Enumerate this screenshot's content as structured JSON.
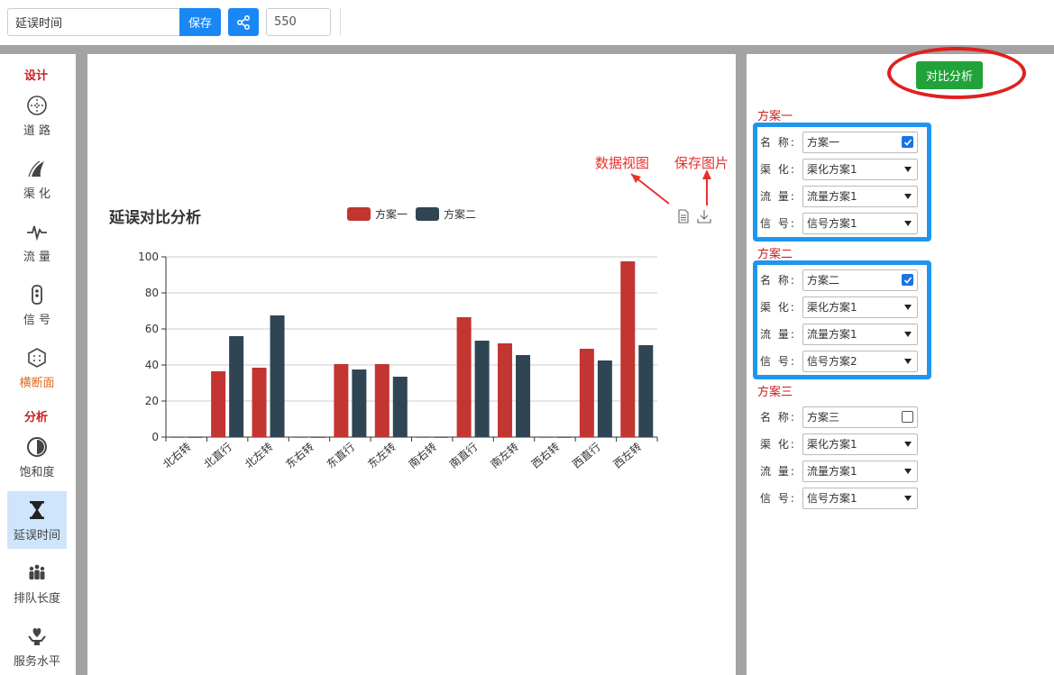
{
  "topbar": {
    "title_value": "延误时间",
    "save_label": "保存",
    "number_value": "550"
  },
  "sidebar": {
    "design_label": "设计",
    "analysis_label": "分析",
    "items": [
      {
        "label": "道 路",
        "icon": "road-circle-icon"
      },
      {
        "label": "渠 化",
        "icon": "channelization-icon"
      },
      {
        "label": "流 量",
        "icon": "pulse-icon"
      },
      {
        "label": "信 号",
        "icon": "traffic-light-icon"
      },
      {
        "label": "横断面",
        "icon": "cross-section-icon"
      },
      {
        "label": "饱和度",
        "icon": "half-circle-icon"
      },
      {
        "label": "延误时间",
        "icon": "hourglass-icon"
      },
      {
        "label": "排队长度",
        "icon": "queue-people-icon"
      },
      {
        "label": "服务水平",
        "icon": "heart-hand-icon"
      }
    ]
  },
  "chart": {
    "annotation_data_view": "数据视图",
    "annotation_save_image": "保存图片"
  },
  "chart_data": {
    "type": "bar",
    "title": "延误对比分析",
    "categories": [
      "北右转",
      "北直行",
      "北左转",
      "东右转",
      "东直行",
      "东左转",
      "南右转",
      "南直行",
      "南左转",
      "西右转",
      "西直行",
      "西左转"
    ],
    "series": [
      {
        "name": "方案一",
        "color": "#c23531",
        "values": [
          0,
          36.5,
          38.5,
          0,
          40.5,
          40.5,
          0,
          66.5,
          52,
          0,
          49,
          97.5
        ]
      },
      {
        "name": "方案二",
        "color": "#2f4554",
        "values": [
          0,
          56,
          67.5,
          0,
          37.5,
          33.5,
          0,
          53.5,
          45.5,
          0,
          42.5,
          51
        ]
      }
    ],
    "yticks": [
      0,
      20,
      40,
      60,
      80,
      100
    ],
    "ylim": [
      0,
      100
    ],
    "xlabel": "",
    "ylabel": "",
    "grid": true,
    "legend_position": "top-center"
  },
  "right": {
    "compare_label": "对比分析",
    "labels": {
      "name": "名 称:",
      "channel": "渠 化:",
      "flow": "流 量:",
      "signal": "信 号:"
    },
    "plans": [
      {
        "title": "方案一",
        "name": "方案一",
        "checked": true,
        "channel": "渠化方案1",
        "flow": "流量方案1",
        "signal": "信号方案1"
      },
      {
        "title": "方案二",
        "name": "方案二",
        "checked": true,
        "channel": "渠化方案1",
        "flow": "流量方案1",
        "signal": "信号方案2"
      },
      {
        "title": "方案三",
        "name": "方案三",
        "checked": false,
        "channel": "渠化方案1",
        "flow": "流量方案1",
        "signal": "信号方案1"
      }
    ]
  },
  "colors": {
    "accent_blue": "#1a88f4",
    "green": "#21a33a",
    "red": "#c81e1e",
    "series_1": "#c23531",
    "series_2": "#2f4554"
  }
}
